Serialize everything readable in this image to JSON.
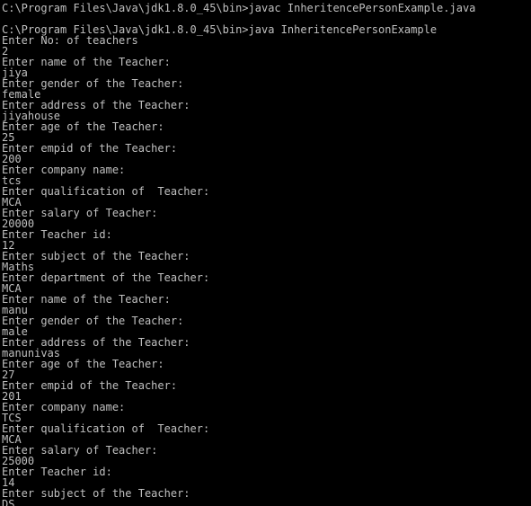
{
  "console": {
    "background": "#000000",
    "foreground": "#c0c0c0",
    "lines": [
      "C:\\Program Files\\Java\\jdk1.8.0_45\\bin>javac InheritencePersonExample.java",
      "",
      "C:\\Program Files\\Java\\jdk1.8.0_45\\bin>java InheritencePersonExample",
      "Enter No: of teachers",
      "2",
      "Enter name of the Teacher:",
      "jiya",
      "Enter gender of the Teacher:",
      "female",
      "Enter address of the Teacher:",
      "jiyahouse",
      "Enter age of the Teacher:",
      "25",
      "Enter empid of the Teacher:",
      "200",
      "Enter company name:",
      "tcs",
      "Enter qualification of  Teacher:",
      "MCA",
      "Enter salary of Teacher:",
      "20000",
      "Enter Teacher id:",
      "12",
      "Enter subject of the Teacher:",
      "Maths",
      "Enter department of the Teacher:",
      "MCA",
      "Enter name of the Teacher:",
      "manu",
      "Enter gender of the Teacher:",
      "male",
      "Enter address of the Teacher:",
      "manunivas",
      "Enter age of the Teacher:",
      "27",
      "Enter empid of the Teacher:",
      "201",
      "Enter company name:",
      "TCS",
      "Enter qualification of  Teacher:",
      "MCA",
      "Enter salary of Teacher:",
      "25000",
      "Enter Teacher id:",
      "14",
      "Enter subject of the Teacher:",
      "DS"
    ]
  }
}
